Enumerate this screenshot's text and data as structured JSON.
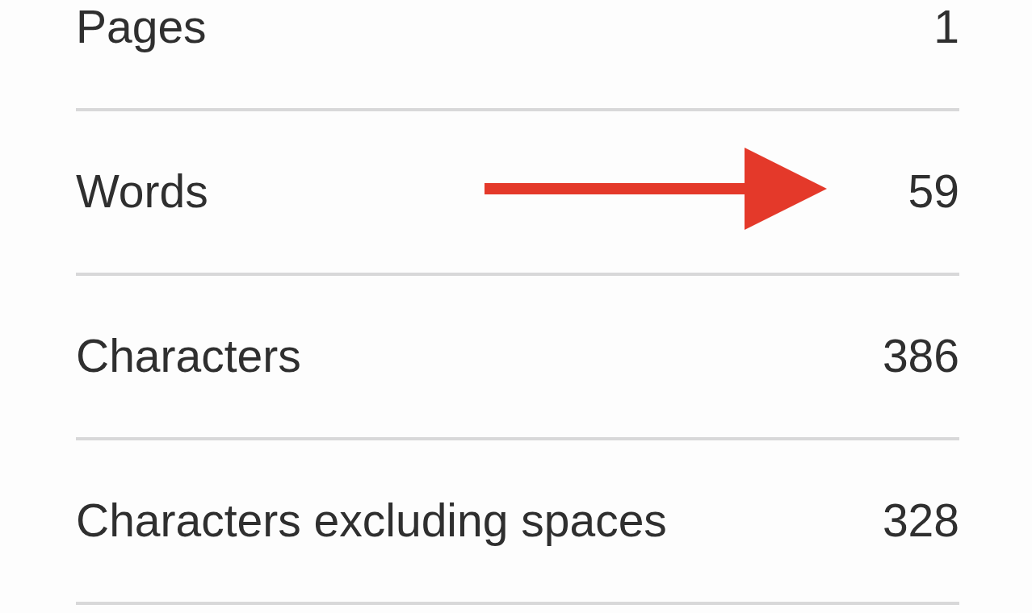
{
  "rows": [
    {
      "label": "Pages",
      "value": "1",
      "pointer_arrow": false
    },
    {
      "label": "Words",
      "value": "59",
      "pointer_arrow": true
    },
    {
      "label": "Characters",
      "value": "386",
      "pointer_arrow": false
    },
    {
      "label": "Characters excluding spaces",
      "value": "328",
      "pointer_arrow": false
    }
  ]
}
